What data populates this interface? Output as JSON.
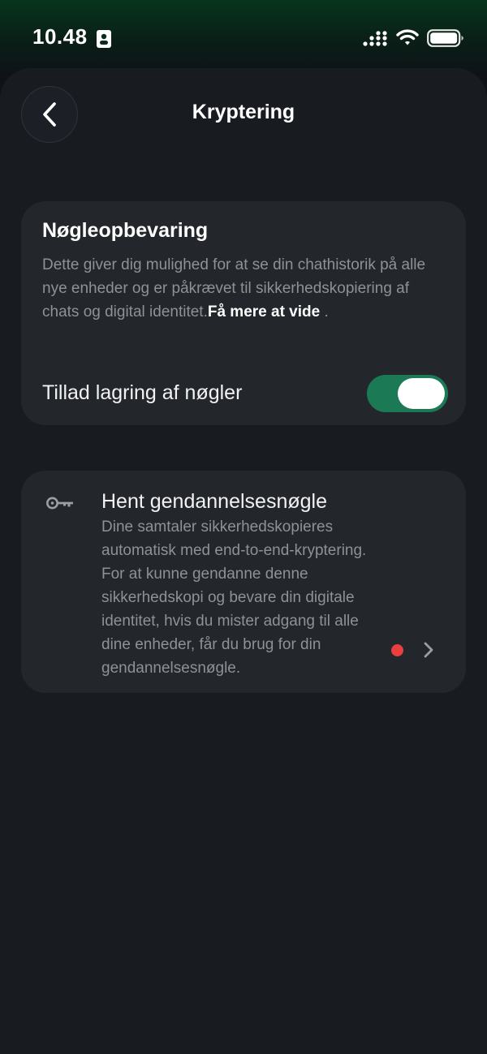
{
  "status_bar": {
    "time": "10.48",
    "icons": [
      "id-card-icon",
      "signal-icon",
      "wifi-icon",
      "battery-icon"
    ]
  },
  "header": {
    "title": "Kryptering",
    "back_icon": "chevron-left-icon"
  },
  "key_storage": {
    "heading": "Nøgleopbevaring",
    "description": "Dette giver dig mulighed for at se din chathistorik på alle nye enheder og er påkrævet til sikkerhedskopiering af chats og digital identitet.",
    "learn_more": "Få mere at vide",
    "trailing": " .",
    "toggle_label": "Tillad lagring af nøgler",
    "toggle_on": true
  },
  "recovery": {
    "icon": "key-icon",
    "title": "Hent gendannelsesnøgle",
    "description": "Dine samtaler sikkerhedskopieres automatisk med end-to-end-kryptering. For at kunne gendanne denne sikkerhedskopi og bevare din digitale identitet, hvis du mister adgang til alle dine enheder, får du brug for din gendannelsesnøgle.",
    "badge": "red-dot"
  },
  "colors": {
    "toggle_on": "#1b7a55",
    "badge": "#e8403f",
    "card": "#23262b",
    "sheet": "#181b20"
  }
}
